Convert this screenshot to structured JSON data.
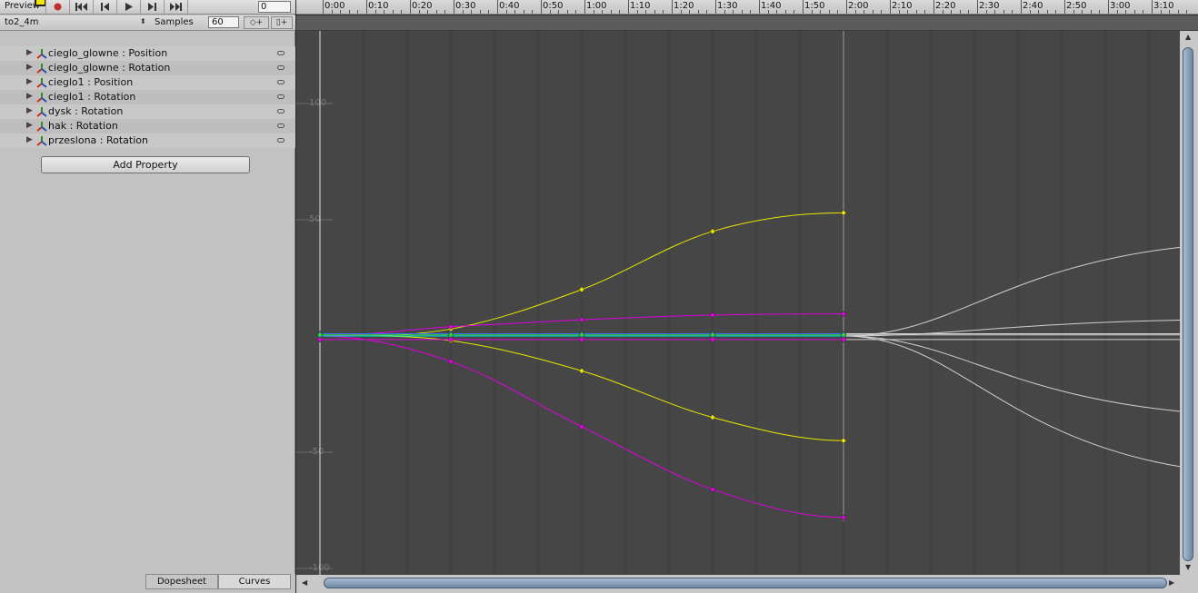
{
  "toolbar": {
    "preview_label": "Preview",
    "frame_value": "0",
    "buttons": [
      "record-icon",
      "first-frame-icon",
      "prev-frame-icon",
      "play-icon",
      "next-frame-icon",
      "last-frame-icon"
    ]
  },
  "clip": {
    "name": "to2_4m",
    "samples_label": "Samples",
    "samples_value": "60",
    "add_keyframe_glyph": "◇+",
    "add_event_glyph": "▯+"
  },
  "properties": [
    {
      "label": "cieglo_glowne : Position"
    },
    {
      "label": "cieglo_glowne : Rotation"
    },
    {
      "label": "cieglo1 : Position"
    },
    {
      "label": "cieglo1 : Rotation"
    },
    {
      "label": "dysk : Rotation"
    },
    {
      "label": "hak : Rotation"
    },
    {
      "label": "przeslona : Rotation"
    }
  ],
  "add_property_label": "Add Property",
  "tabs": {
    "dopesheet": "Dopesheet",
    "curves": "Curves",
    "active": "curves"
  },
  "timeline": {
    "labels": [
      "0:00",
      "0:10",
      "0:20",
      "0:30",
      "0:40",
      "0:50",
      "1:00",
      "1:10",
      "1:20",
      "1:30",
      "1:40",
      "1:50",
      "2:00",
      "2:10",
      "2:20",
      "2:30",
      "2:40",
      "2:50",
      "3:00",
      "3:10"
    ],
    "end_label": "2:00"
  },
  "value_axis": {
    "labels": [
      "100",
      "50",
      "-50",
      "-100"
    ],
    "values": [
      100,
      50,
      -50,
      -100
    ]
  },
  "curves": {
    "colors": {
      "yellow": "#e8e800",
      "magenta": "#e000e0",
      "cyan": "#00d8e8",
      "blue": "#3a6cff",
      "green": "#34d634",
      "white": "#d0d0d0"
    },
    "keyframe_times_s": [
      0,
      30,
      60,
      90,
      120
    ],
    "series": [
      {
        "color": "yellow",
        "values": [
          0,
          3,
          20,
          45,
          53
        ]
      },
      {
        "color": "magenta",
        "values": [
          0,
          4,
          7,
          9,
          9.5
        ]
      },
      {
        "color": "yellow",
        "values": [
          0,
          -2,
          -15,
          -35,
          -45
        ]
      },
      {
        "color": "magenta",
        "values": [
          0,
          -11,
          -39,
          -66,
          -78
        ]
      },
      {
        "color": "cyan",
        "values": [
          0,
          0,
          0,
          0,
          0
        ]
      },
      {
        "color": "blue",
        "values": [
          1,
          1,
          1,
          1,
          1
        ]
      },
      {
        "color": "green",
        "values": [
          0.5,
          0.5,
          0.5,
          0.5,
          0.5
        ]
      },
      {
        "color": "magenta",
        "values": [
          -1.5,
          -1.5,
          -1.5,
          -1.5,
          -1.5
        ]
      }
    ]
  },
  "colors": {
    "panel": "#c2c2c2",
    "curve_bg": "#464646",
    "record": "#c0302a"
  }
}
